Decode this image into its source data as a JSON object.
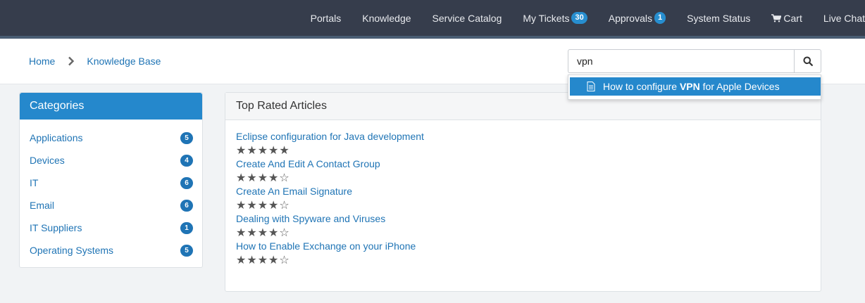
{
  "nav": {
    "items": [
      {
        "label": "Portals"
      },
      {
        "label": "Knowledge"
      },
      {
        "label": "Service Catalog"
      },
      {
        "label": "My Tickets",
        "badge": "30"
      },
      {
        "label": "Approvals",
        "badge": "1"
      },
      {
        "label": "System Status"
      },
      {
        "label": "Cart",
        "icon": "cart-icon"
      },
      {
        "label": "Live Chat"
      }
    ]
  },
  "breadcrumb": {
    "home": "Home",
    "current": "Knowledge Base"
  },
  "search": {
    "value": "vpn",
    "suggestion_prefix": "How to configure ",
    "suggestion_match": "VPN",
    "suggestion_suffix": " for Apple Devices"
  },
  "categories": {
    "title": "Categories",
    "items": [
      {
        "label": "Applications",
        "count": "5"
      },
      {
        "label": "Devices",
        "count": "4"
      },
      {
        "label": "IT",
        "count": "6"
      },
      {
        "label": "Email",
        "count": "6"
      },
      {
        "label": "IT Suppliers",
        "count": "1"
      },
      {
        "label": "Operating Systems",
        "count": "5"
      }
    ]
  },
  "top_rated": {
    "title": "Top Rated Articles",
    "articles": [
      {
        "title": "Eclipse configuration for Java development",
        "rating": 5
      },
      {
        "title": "Create And Edit A Contact Group",
        "rating": 4
      },
      {
        "title": "Create An Email Signature",
        "rating": 4
      },
      {
        "title": "Dealing with Spyware and Viruses",
        "rating": 4
      },
      {
        "title": "How to Enable Exchange on your iPhone",
        "rating": 4
      }
    ]
  },
  "colors": {
    "nav_bg": "#363d4c",
    "accent": "#2588cc",
    "link": "#1f74b5"
  }
}
